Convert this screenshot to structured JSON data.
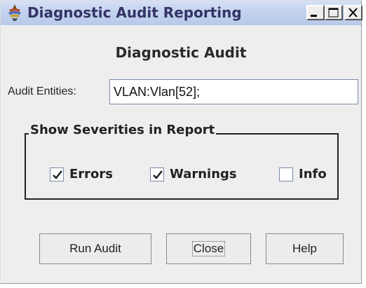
{
  "window": {
    "title": "Diagnostic Audit Reporting",
    "controls": {
      "minimize": "minimize-icon",
      "maximize": "maximize-icon",
      "close": "close-icon"
    }
  },
  "dialog": {
    "heading": "Diagnostic Audit",
    "audit_entities": {
      "label": "Audit Entities:",
      "value": "VLAN:Vlan[52];"
    },
    "severities": {
      "legend": "Show Severities in Report",
      "options": [
        {
          "label": "Errors",
          "checked": true
        },
        {
          "label": "Warnings",
          "checked": true
        },
        {
          "label": "Info",
          "checked": false
        }
      ]
    },
    "buttons": {
      "run": "Run Audit",
      "close": "Close",
      "help": "Help"
    }
  },
  "colors": {
    "titlebar": "#c3d2ee",
    "title_text": "#333366",
    "background": "#eeeeee"
  }
}
